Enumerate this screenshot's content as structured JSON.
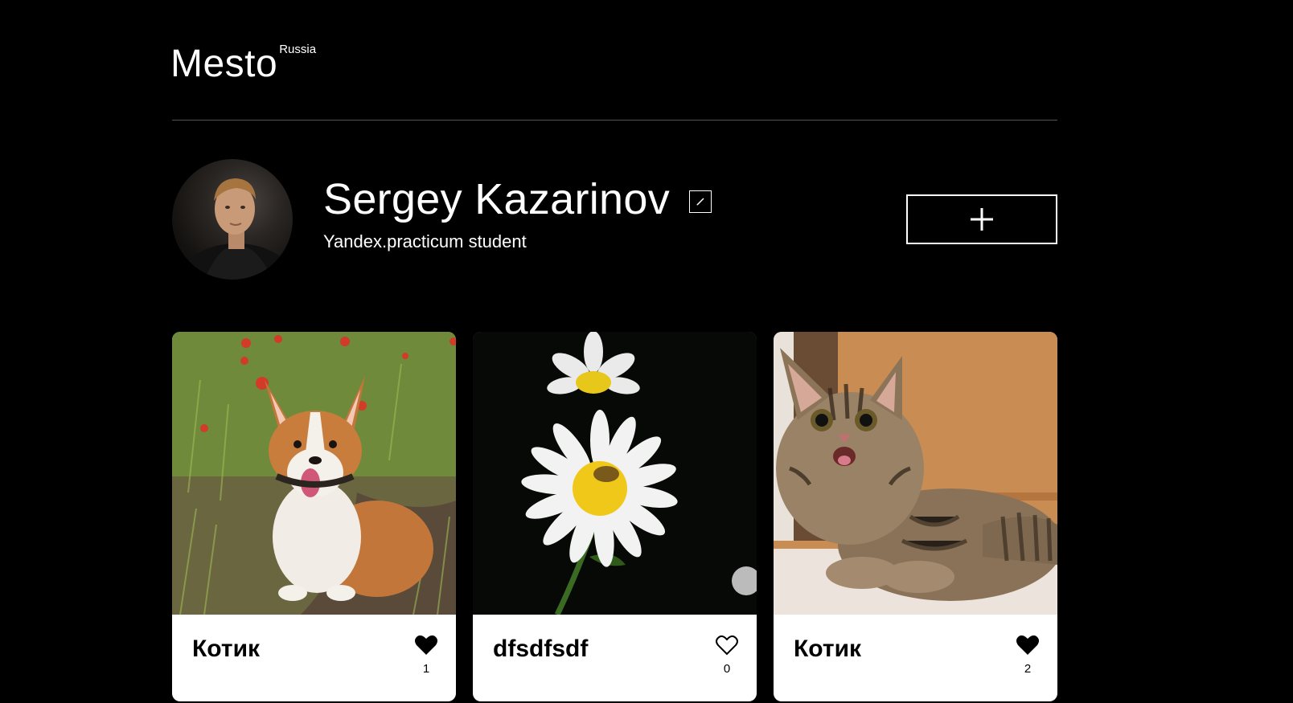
{
  "header": {
    "logo": "Mesto",
    "logo_sub": "Russia"
  },
  "profile": {
    "name": "Sergey Kazarinov",
    "about": "Yandex.practicum student"
  },
  "cards": [
    {
      "title": "Котик",
      "likes": "1",
      "liked": true,
      "image": "corgi-photo"
    },
    {
      "title": "dfsdfsdf",
      "likes": "0",
      "liked": false,
      "image": "daisy-photo"
    },
    {
      "title": "Котик",
      "likes": "2",
      "liked": true,
      "image": "cat-photo"
    }
  ],
  "colors": {
    "background": "#000000",
    "card": "#ffffff",
    "divider": "#545454"
  }
}
